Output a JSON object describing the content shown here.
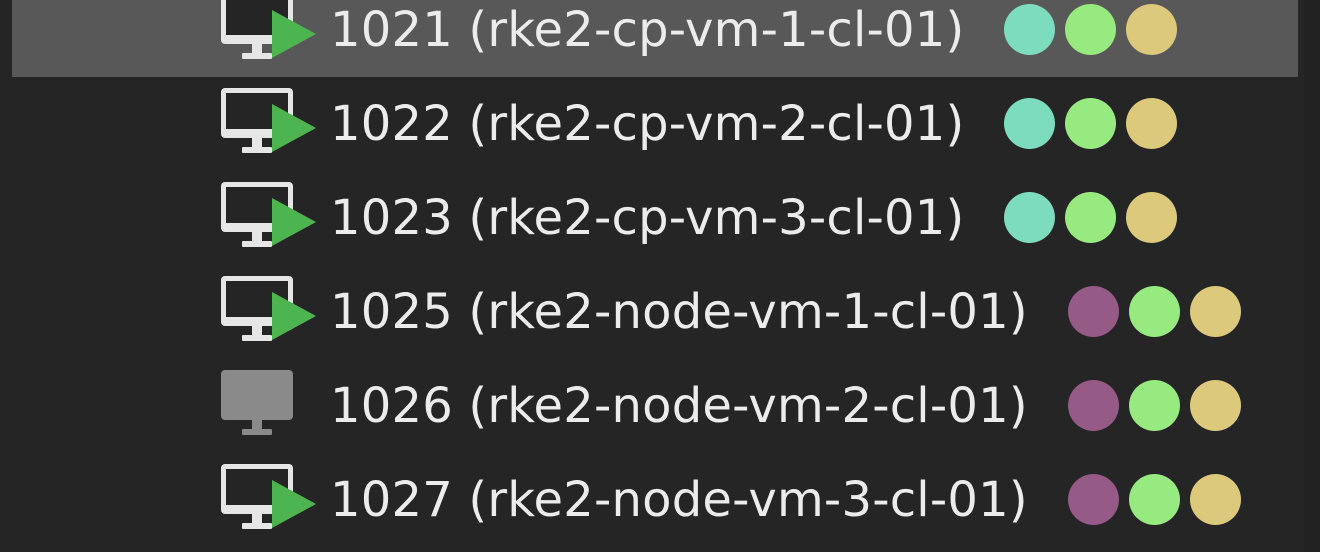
{
  "colors": {
    "panel_bg": "#252525",
    "selected_bg": "#585858",
    "text": "#ececec",
    "running_badge": "#4cb54f",
    "monitor_on": "#e6e6e6",
    "monitor_off": "#8a8a8a",
    "tag_cyan": "#7ddcbd",
    "tag_purple": "#955a86",
    "tag_green": "#97ea80",
    "tag_yellow": "#dcc97c"
  },
  "vms": [
    {
      "label": "1021 (rke2-cp-vm-1-cl-01)",
      "status": "running",
      "icon": "vm-running-icon",
      "selected": true,
      "tags": [
        "tag_cyan",
        "tag_green",
        "tag_yellow"
      ]
    },
    {
      "label": "1022 (rke2-cp-vm-2-cl-01)",
      "status": "running",
      "icon": "vm-running-icon",
      "selected": false,
      "tags": [
        "tag_cyan",
        "tag_green",
        "tag_yellow"
      ]
    },
    {
      "label": "1023 (rke2-cp-vm-3-cl-01)",
      "status": "running",
      "icon": "vm-running-icon",
      "selected": false,
      "tags": [
        "tag_cyan",
        "tag_green",
        "tag_yellow"
      ]
    },
    {
      "label": "1025 (rke2-node-vm-1-cl-01)",
      "status": "running",
      "icon": "vm-running-icon",
      "selected": false,
      "tags": [
        "tag_purple",
        "tag_green",
        "tag_yellow"
      ]
    },
    {
      "label": "1026 (rke2-node-vm-2-cl-01)",
      "status": "stopped",
      "icon": "vm-stopped-icon",
      "selected": false,
      "tags": [
        "tag_purple",
        "tag_green",
        "tag_yellow"
      ]
    },
    {
      "label": "1027 (rke2-node-vm-3-cl-01)",
      "status": "running",
      "icon": "vm-running-icon",
      "selected": false,
      "tags": [
        "tag_purple",
        "tag_green",
        "tag_yellow"
      ]
    }
  ]
}
